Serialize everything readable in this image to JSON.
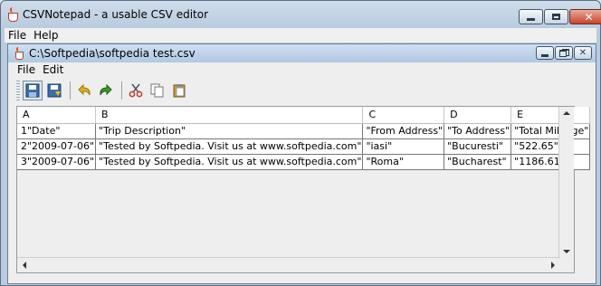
{
  "app": {
    "title": "CSVNotepad - a usable CSV editor"
  },
  "app_menu": [
    "File",
    "Help"
  ],
  "document": {
    "title": "C:\\Softpedia\\softpedia test.csv"
  },
  "doc_menu": [
    "File",
    "Edit"
  ],
  "toolbar": {
    "buttons": [
      "save-icon",
      "save-as-icon",
      "undo-icon",
      "redo-icon",
      "cut-icon",
      "copy-icon",
      "paste-icon"
    ]
  },
  "table": {
    "columns": [
      "A",
      "B",
      "C",
      "D",
      "E"
    ],
    "rows": [
      [
        "1",
        "\"Date\"",
        "\"Trip Description\"",
        "\"From Address\"",
        "\"To Address\"",
        "\"Total Mileage\""
      ],
      [
        "2",
        "\"2009-07-06\"",
        "\"Tested by Softpedia. Visit us at www.softpedia.com\"",
        "\"iasi\"",
        "\"Bucuresti\"",
        "\"522.65\""
      ],
      [
        "3",
        "\"2009-07-06\"",
        "\"Tested by Softpedia. Visit us at www.softpedia.com\"",
        "\"Roma\"",
        "\"Bucharest\"",
        "\"1186.61\""
      ]
    ]
  },
  "colors": {
    "title_gradient_top": "#cfdceb",
    "close_red": "#c9452b",
    "undo_yellow": "#e0b020",
    "redo_green": "#3a9a2a"
  }
}
